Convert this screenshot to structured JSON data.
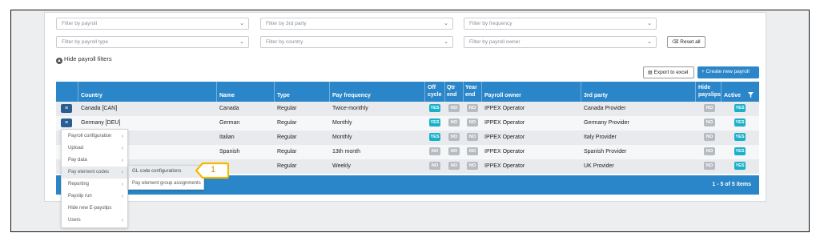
{
  "filters": {
    "payroll": "Filter by payroll",
    "third_party": "Filter by 3rd party",
    "frequency": "Filter by frequency",
    "payroll_type": "Filter by payroll type",
    "country": "Filter by country",
    "owner": "Filter by payroll owner",
    "reset_label": "Reset all",
    "hide_label": "Hide payroll filters"
  },
  "actions": {
    "export_label": "Export to excel",
    "create_label": "+ Create new payroll"
  },
  "table": {
    "headers": {
      "country": "Country",
      "name": "Name",
      "type": "Type",
      "pay_frequency": "Pay frequency",
      "off_cycle_1": "Off",
      "off_cycle_2": "cycle",
      "qtr_end_1": "Qtr",
      "qtr_end_2": "end",
      "year_end_1": "Year",
      "year_end_2": "end",
      "owner": "Payroll owner",
      "third_party": "3rd party",
      "hide_payslips_1": "Hide",
      "hide_payslips_2": "payslips",
      "active": "Active"
    },
    "rows": [
      {
        "country": "Canada [CAN]",
        "name": "Canada",
        "type": "Regular",
        "frequency": "Twice-monthly",
        "off_cycle": "YES",
        "qtr_end": "NO",
        "year_end": "NO",
        "owner": "IPPEX Operator",
        "third_party": "Canada Provider",
        "hide_payslips": "NO",
        "active": "YES"
      },
      {
        "country": "Germany [DEU]",
        "name": "German",
        "type": "Regular",
        "frequency": "Monthly",
        "off_cycle": "YES",
        "qtr_end": "NO",
        "year_end": "NO",
        "owner": "IPPEX Operator",
        "third_party": "Germany Provider",
        "hide_payslips": "NO",
        "active": "YES"
      },
      {
        "country": "",
        "name": "Italian",
        "type": "Regular",
        "frequency": "Monthly",
        "off_cycle": "YES",
        "qtr_end": "NO",
        "year_end": "NO",
        "owner": "IPPEX Operator",
        "third_party": "Italy Provider",
        "hide_payslips": "NO",
        "active": "YES"
      },
      {
        "country": "",
        "name": "Spanish",
        "type": "Regular",
        "frequency": "13th month",
        "off_cycle": "NO",
        "qtr_end": "NO",
        "year_end": "NO",
        "owner": "IPPEX Operator",
        "third_party": "Spanish Provider",
        "hide_payslips": "NO",
        "active": "YES"
      },
      {
        "country": "",
        "name": "",
        "type": "Regular",
        "frequency": "Weekly",
        "off_cycle": "NO",
        "qtr_end": "NO",
        "year_end": "NO",
        "owner": "IPPEX Operator",
        "third_party": "UK Provider",
        "hide_payslips": "NO",
        "active": "YES"
      }
    ],
    "footer_count": "1 - 5 of 5 items"
  },
  "context_menu": {
    "items": [
      "Payroll configuration",
      "Upload",
      "Pay data",
      "Pay element codes",
      "Reporting",
      "Payslip run",
      "Hide new E-payslips",
      "Users"
    ],
    "submenu": [
      "GL code configurations",
      "Pay element group assignments"
    ]
  },
  "callout_number": "1",
  "colors": {
    "header_blue": "#2a86c8",
    "yes_badge": "#1ab0c9",
    "no_badge": "#b7bcc2",
    "callout": "#f5b800"
  }
}
